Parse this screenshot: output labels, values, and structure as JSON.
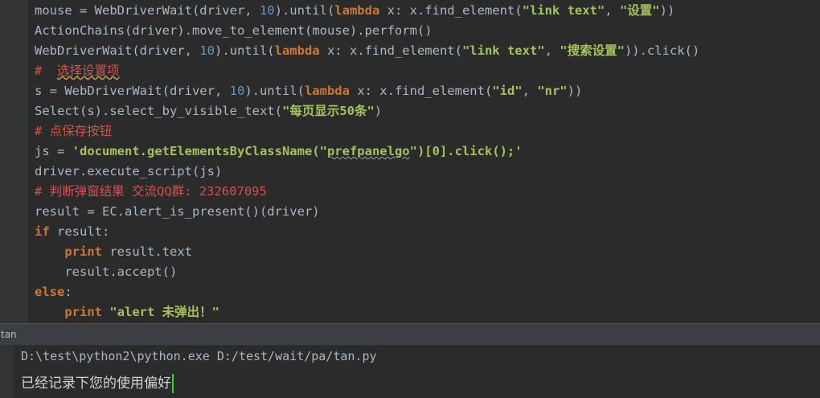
{
  "editor": {
    "lines": [
      [
        {
          "t": "mouse = WebDriverWait(driver, ",
          "c": ""
        },
        {
          "t": "10",
          "c": "num"
        },
        {
          "t": ").until(",
          "c": ""
        },
        {
          "t": "lambda",
          "c": "kw"
        },
        {
          "t": " x: x.find_element(",
          "c": ""
        },
        {
          "t": "\"link text\"",
          "c": "str-b"
        },
        {
          "t": ", ",
          "c": ""
        },
        {
          "t": "\"设置\"",
          "c": "str-b"
        },
        {
          "t": "))",
          "c": ""
        }
      ],
      [
        {
          "t": "ActionChains(driver).move_to_element(mouse).perform()",
          "c": ""
        }
      ],
      [
        {
          "t": "WebDriverWait(driver, ",
          "c": ""
        },
        {
          "t": "10",
          "c": "num"
        },
        {
          "t": ").until(",
          "c": ""
        },
        {
          "t": "lambda",
          "c": "kw"
        },
        {
          "t": " x: x.find_element(",
          "c": ""
        },
        {
          "t": "\"link text\"",
          "c": "str-b"
        },
        {
          "t": ", ",
          "c": ""
        },
        {
          "t": "\"搜索设置\"",
          "c": "str-b"
        },
        {
          "t": ")).click()",
          "c": ""
        }
      ],
      [
        {
          "t": "#  ",
          "c": "cmt"
        },
        {
          "t": "选择设置项",
          "c": "cmt warn"
        }
      ],
      [
        {
          "t": "s = WebDriverWait(driver, ",
          "c": ""
        },
        {
          "t": "10",
          "c": "num"
        },
        {
          "t": ").until(",
          "c": ""
        },
        {
          "t": "lambda",
          "c": "kw"
        },
        {
          "t": " x: x.find_element(",
          "c": ""
        },
        {
          "t": "\"id\"",
          "c": "str-b"
        },
        {
          "t": ", ",
          "c": ""
        },
        {
          "t": "\"nr\"",
          "c": "str-b"
        },
        {
          "t": "))",
          "c": ""
        }
      ],
      [
        {
          "t": "Select(s).select_by_visible_text(",
          "c": ""
        },
        {
          "t": "\"每页显示50条\"",
          "c": "str-b"
        },
        {
          "t": ")",
          "c": ""
        }
      ],
      [
        {
          "t": "# 点保存按钮",
          "c": "cmt"
        }
      ],
      [
        {
          "t": "js = ",
          "c": ""
        },
        {
          "t": "'document.getElementsByClassName(\"",
          "c": "str-b"
        },
        {
          "t": "prefpanelgo",
          "c": "str-b sq"
        },
        {
          "t": "\")[0].click();'",
          "c": "str-b"
        }
      ],
      [
        {
          "t": "driver.execute_script(js)",
          "c": ""
        }
      ],
      [
        {
          "t": "# 判断弹窗结果 交流QQ群: 232607095",
          "c": "cmt"
        }
      ],
      [
        {
          "t": "result = EC.alert_is_present()(driver)",
          "c": ""
        }
      ],
      [
        {
          "t": "if",
          "c": "kw"
        },
        {
          "t": " result:",
          "c": ""
        }
      ],
      [
        {
          "t": "    ",
          "c": ""
        },
        {
          "t": "print",
          "c": "kw"
        },
        {
          "t": " result.text",
          "c": ""
        }
      ],
      [
        {
          "t": "    result.accept()",
          "c": ""
        }
      ],
      [
        {
          "t": "else",
          "c": "kw"
        },
        {
          "t": ":",
          "c": ""
        }
      ],
      [
        {
          "t": "    ",
          "c": ""
        },
        {
          "t": "print",
          "c": "kw"
        },
        {
          "t": " ",
          "c": ""
        },
        {
          "t": "\"alert 未弹出！\"",
          "c": "str-b"
        }
      ]
    ]
  },
  "run_panel": {
    "tab_label": "tan",
    "command": "D:\\test\\python2\\python.exe D:/test/wait/pa/tan.py",
    "output": "已经记录下您的使用偏好"
  },
  "colors": {
    "keyword": "#cc7832",
    "number": "#6897bb",
    "string": "#a5c25c",
    "comment": "#d0534f",
    "caret": "#31d630"
  }
}
